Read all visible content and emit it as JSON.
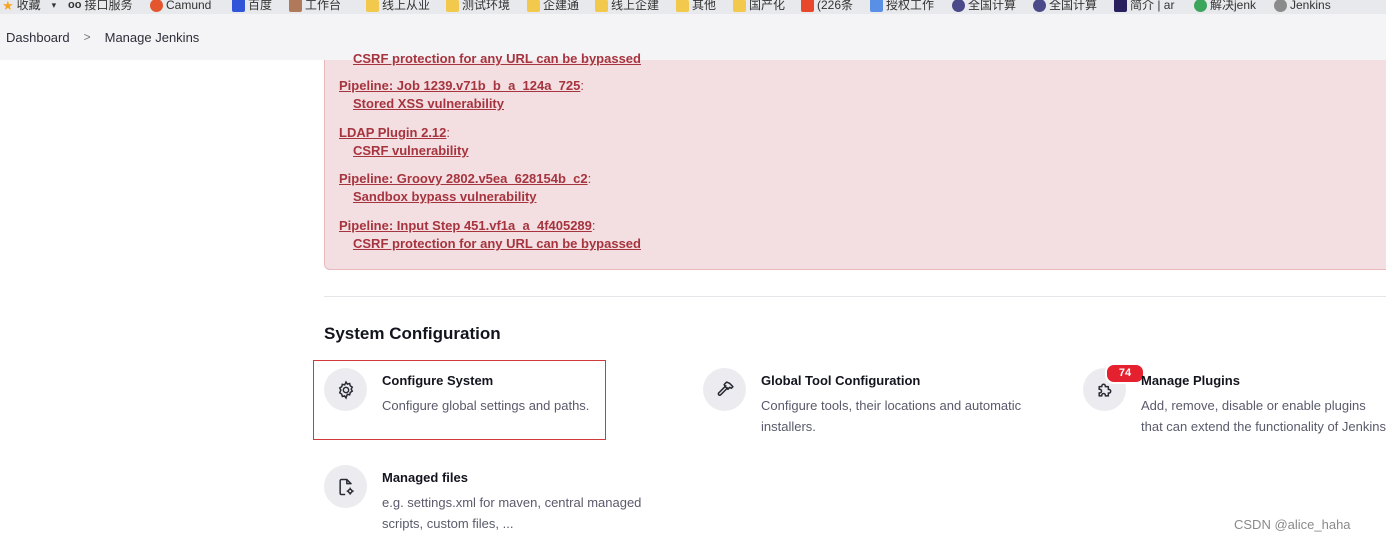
{
  "bookmarks": [
    {
      "label": "收藏",
      "icon": "star-icon"
    },
    {
      "label": "接口服务",
      "icon": "owl-icon"
    },
    {
      "label": "Camund",
      "icon": "camunda-icon"
    },
    {
      "label": "百度",
      "icon": "baidu-icon"
    },
    {
      "label": "工作台",
      "icon": "avatar-icon"
    },
    {
      "label": "线上从业",
      "icon": "folder-icon"
    },
    {
      "label": "测试环境",
      "icon": "folder-icon"
    },
    {
      "label": "企建通",
      "icon": "folder-icon"
    },
    {
      "label": "线上企建",
      "icon": "folder-icon"
    },
    {
      "label": "其他",
      "icon": "folder-icon"
    },
    {
      "label": "国产化",
      "icon": "folder-icon"
    },
    {
      "label": "(226条",
      "icon": "csdn-icon"
    },
    {
      "label": "授权工作",
      "icon": "puzzle-icon"
    },
    {
      "label": "全国计算",
      "icon": "globe-icon"
    },
    {
      "label": "全国计算",
      "icon": "globe-icon"
    },
    {
      "label": "简介 | ar",
      "icon": "ar-icon"
    },
    {
      "label": "解决jenk",
      "icon": "c-icon"
    },
    {
      "label": "Jenkins",
      "icon": "jenkins-icon"
    }
  ],
  "breadcrumb": {
    "items": [
      "Dashboard",
      "Manage Jenkins"
    ],
    "separator": ">"
  },
  "warnings": [
    {
      "plugin": "",
      "issue": "CSRF protection for any URL can be bypassed"
    },
    {
      "plugin": "Pipeline: Job 1239.v71b_b_a_124a_725",
      "issue": "Stored XSS vulnerability"
    },
    {
      "plugin": "LDAP Plugin 2.12",
      "issue": "CSRF vulnerability"
    },
    {
      "plugin": "Pipeline: Groovy 2802.v5ea_628154b_c2",
      "issue": "Sandbox bypass vulnerability"
    },
    {
      "plugin": "Pipeline: Input Step 451.vf1a_a_4f405289",
      "issue": "CSRF protection for any URL can be bypassed"
    }
  ],
  "section": {
    "title": "System Configuration"
  },
  "tiles": [
    {
      "title": "Configure System",
      "desc": "Configure global settings and paths.",
      "icon": "gear-icon"
    },
    {
      "title": "Global Tool Configuration",
      "desc": "Configure tools, their locations and automatic installers.",
      "icon": "hammer-icon"
    },
    {
      "title": "Manage Plugins",
      "desc": "Add, remove, disable or enable plugins that can extend the functionality of Jenkins.",
      "icon": "puzzle-icon",
      "badge": "74"
    },
    {
      "title": "Managed files",
      "desc": "e.g. settings.xml for maven, central managed scripts, custom files, ...",
      "icon": "file-gear-icon"
    }
  ],
  "watermark": "CSDN @alice_haha",
  "colors": {
    "warning_text": "#a6343f",
    "warning_bg": "#f3dfe1",
    "badge": "#e5202f",
    "highlight": "#cf3a3a"
  }
}
